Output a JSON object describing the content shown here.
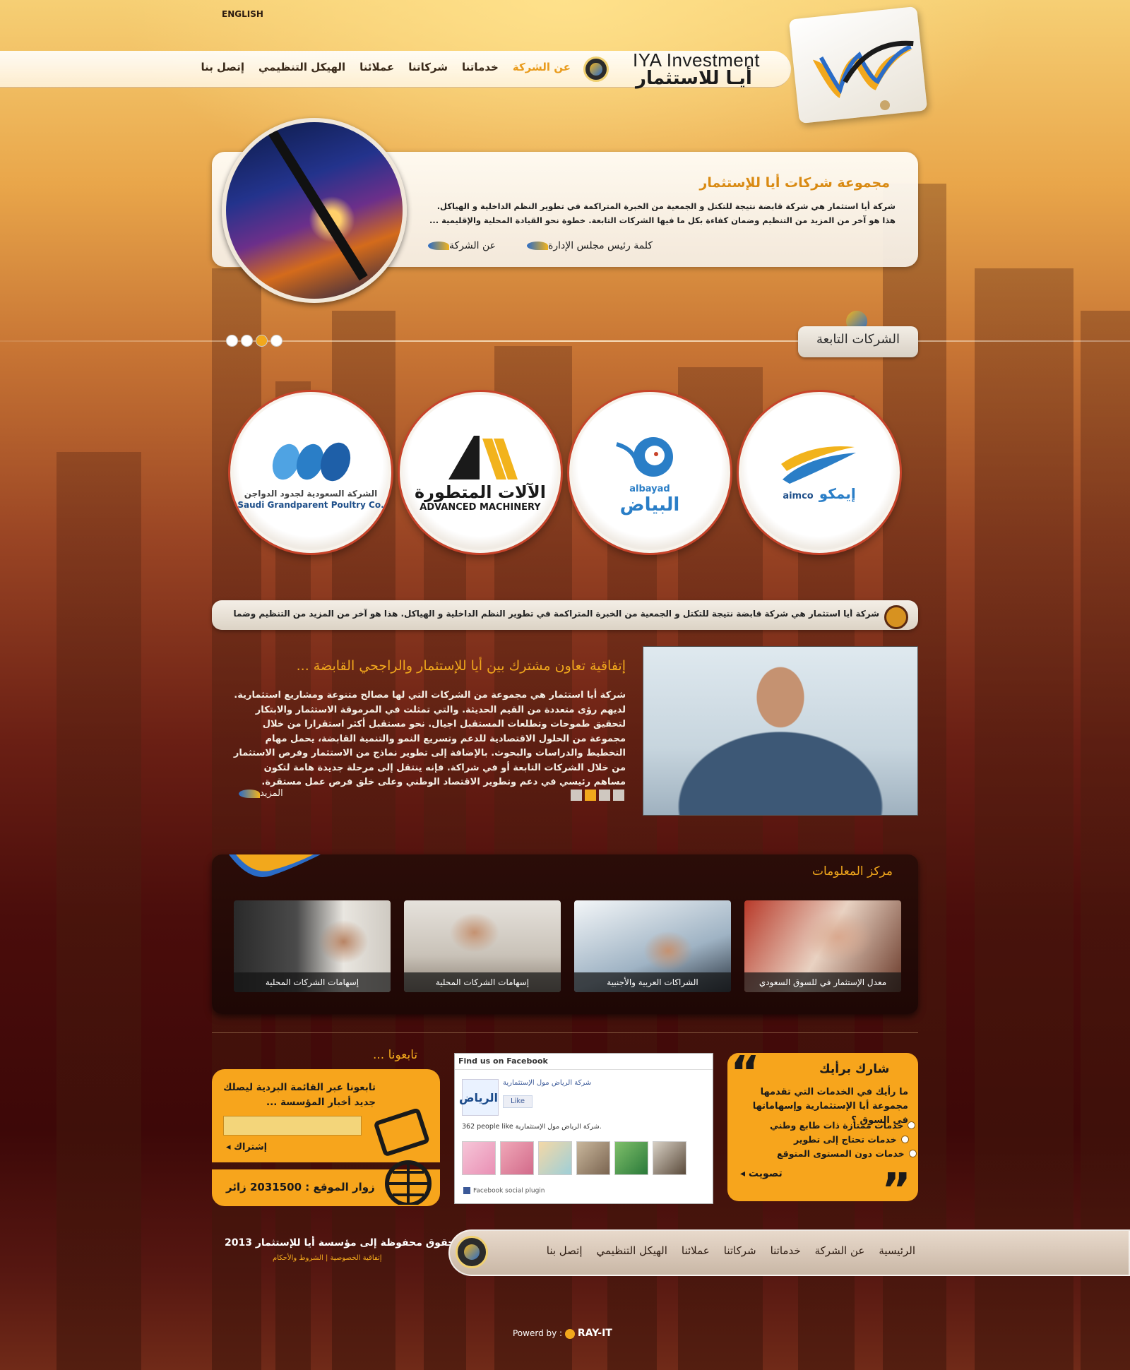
{
  "top": {
    "language_link": "ENGLISH"
  },
  "brand": {
    "name_en": "IYA Investment",
    "name_ar": "أيـا للاستثمار"
  },
  "nav": {
    "items": [
      "عن الشركة",
      "خدماتنا",
      "شركاتنا",
      "عملائنا",
      "الهيكل التنظيمي",
      "إتصل بنا"
    ],
    "active_index": 0
  },
  "hero": {
    "title": "مجموعة شركات أيا للإستثمار",
    "text": "شركة أيا استثمار هي شركة قابضة نتيجة للتكتل و الجمعية من الخبرة المتراكمة في تطوير النظم الداخلية و الهياكل. هذا هو آخر من المزيد من التنظيم وضمان كفاءة بكل ما فيها الشركات التابعة. خطوة نحو القيادة المحلية والإقليمية ...",
    "link_chairman": "كلمة رئيس مجلس الإدارة",
    "link_about": "عن الشركة",
    "slides": 4,
    "active_slide": 3
  },
  "subsidiaries": {
    "title": "الشركات التابعة",
    "items": [
      {
        "name_ar": "إيمكو",
        "name_en": "aimco"
      },
      {
        "name_ar": "البياض",
        "name_en": "albayad"
      },
      {
        "name_ar": "الآلات المتطورة",
        "name_en": "ADVANCED MACHINERY"
      },
      {
        "name_ar": "الشركة السعودية لجدود الدواجن",
        "name_en": "Saudi Grandparent Poultry Co."
      }
    ]
  },
  "ticker": {
    "text": "شركة أيا استثمار هي شركة قابضة نتيجة للتكتل و الجمعية من الخبرة المتراكمة في تطوير النظم الداخلية و الهياكل. هذا هو آخر من المزيد من التنظيم وضمان كفاءة ..."
  },
  "news": {
    "title": "إتفاقية تعاون مشترك بين أيا للإستثمار والراجحي القابضة ...",
    "body": "شركة أيا استثمار هي مجموعة من الشركات التي لها مصالح متنوعة ومشاريع استثمارية. لديهم رؤى متعددة من القيم الحديثة. والتي تمثلت في المرموقة الاستثمار والابتكار لتحقيق طموحات وتطلعات المستقبل اجيال. نحو مستقبل أكثر استقرارا من خلال مجموعة من الحلول الاقتصادية للدعم وتسريع النمو والتنمية القابضة، يحمل مهام التخطيط والدراسات والبحوث. بالإضافة إلى تطوير نماذج من الاستثمار وفرص الاستثمار من خلال الشركات التابعة أو في شراكة. فإنه ينتقل إلى مرحلة جديدة هامة لتكون مساهم رئيسي في دعم وتطوير الاقتصاد الوطني وعلى خلق فرص عمل مستقرة.",
    "more": "المزيد",
    "pages": 4,
    "active_page": 2
  },
  "info_center": {
    "title": "مركز المعلومات",
    "items": [
      {
        "caption": "معدل الإستثمار في للسوق السعودي"
      },
      {
        "caption": "الشراكات العربية والأجنبية"
      },
      {
        "caption": "إسهامات الشركات المحلية"
      },
      {
        "caption": "إسهامات الشركات المحلية"
      }
    ]
  },
  "follow": {
    "title": "تابعونا ...",
    "text": "تابعونا عبر القائمة البردية ليصلك جديد أخبار المؤسسة ...",
    "subscribe": "إشتراك",
    "visitors_label": "زوار الموقع : 2031500 زائر"
  },
  "facebook": {
    "header": "Find us on Facebook",
    "page_name": "شركة الرياض مول الإستثمارية",
    "logo_text": "الرياض",
    "like": "Like",
    "count_text": "362 people like شركة الرياض مول الإستثمارية.",
    "footer": "Facebook social plugin"
  },
  "poll": {
    "title": "شارك برأيك",
    "question": "ما رأيك في الخدمات التي تقدمها مجموعة أيا الإستثمارية وإسهاماتها في السوق ؟",
    "options": [
      "خدمات ممتازة ذات طابع وطني",
      "خدمات تحتاج إلى تطوير",
      "خدمات دون المستوى المتوقع"
    ],
    "vote": "تصويت"
  },
  "footer": {
    "copyright": "جميع الحقوق محفوظة إلى مؤسسة أيا للإستثمار 2013",
    "legal": "إتفاقية الخصوصية | الشروط والأحكام",
    "nav": [
      "الرئيسية",
      "عن الشركة",
      "خدماتنا",
      "شركاتنا",
      "عملائنا",
      "الهيكل التنظيمي",
      "إتصل بنا"
    ],
    "powered_label": "Powerd by :",
    "powered_brand": "RAY-IT"
  },
  "colors": {
    "accent": "#f2a81c",
    "dark": "#3d0808",
    "panel": "#f7a51c"
  }
}
